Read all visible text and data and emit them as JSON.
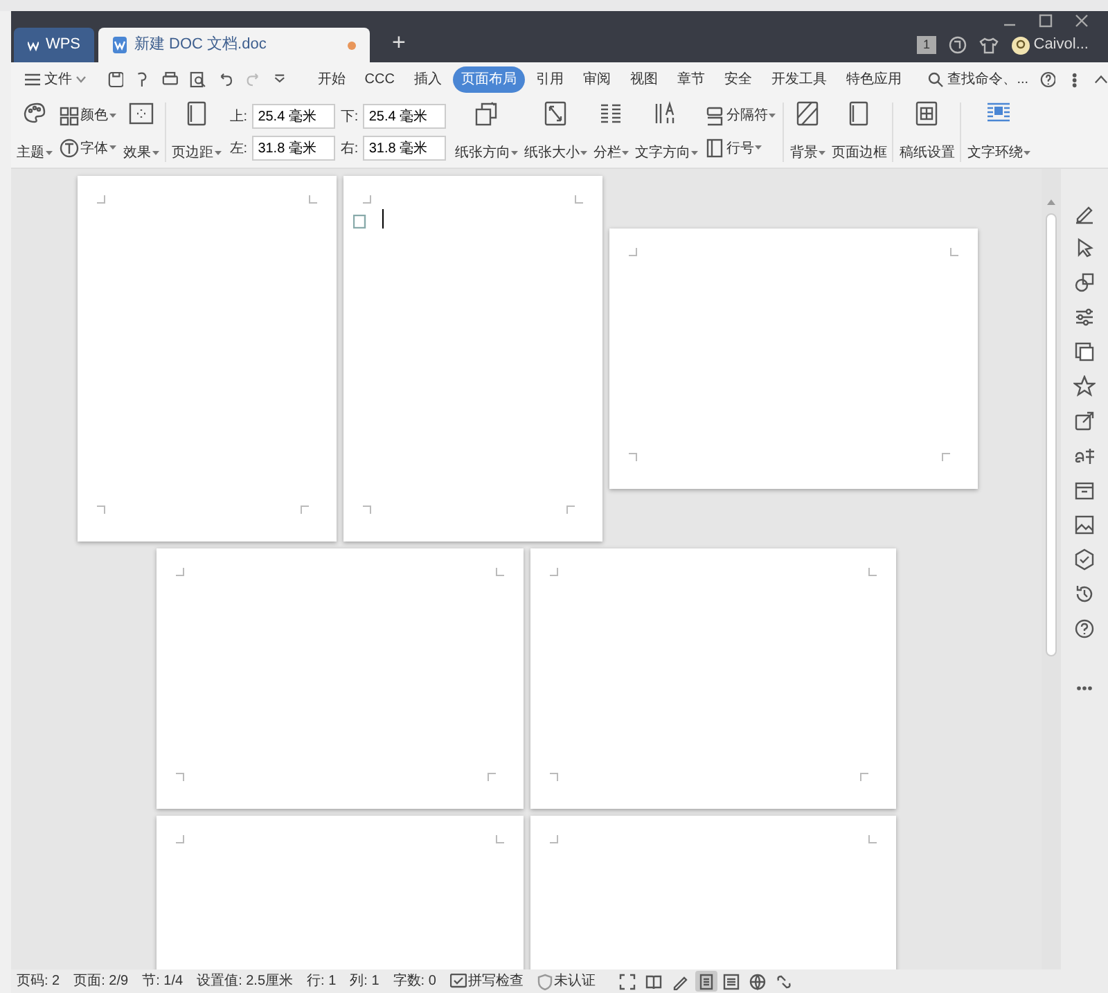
{
  "window": {
    "tabs": [
      {
        "kind": "home",
        "label": "WPS",
        "selected": false,
        "modified": false
      },
      {
        "kind": "document",
        "label": "新建 DOC 文档.doc",
        "selected": true,
        "modified": true
      }
    ],
    "new_tab": "+",
    "notice_count": "1",
    "user": "Caivol..."
  },
  "menu": {
    "file": "文件",
    "tabs": [
      {
        "label": "开始",
        "selected": false
      },
      {
        "label": "CCC",
        "selected": false
      },
      {
        "label": "插入",
        "selected": false
      },
      {
        "label": "页面布局",
        "selected": true
      },
      {
        "label": "引用",
        "selected": false
      },
      {
        "label": "审阅",
        "selected": false
      },
      {
        "label": "视图",
        "selected": false
      },
      {
        "label": "章节",
        "selected": false
      },
      {
        "label": "安全",
        "selected": false
      },
      {
        "label": "开发工具",
        "selected": false
      },
      {
        "label": "特色应用",
        "selected": false
      }
    ],
    "search": "查找命令、..."
  },
  "ribbon": [
    {
      "kind": "large",
      "label": "主题",
      "dropdown": true
    },
    {
      "kind": "stack",
      "items": [
        {
          "label": "颜色",
          "dropdown": true
        },
        {
          "label": "字体",
          "dropdown": true
        }
      ]
    },
    {
      "kind": "large",
      "label": "效果",
      "dropdown": true
    },
    {
      "kind": "divider"
    },
    {
      "kind": "large",
      "label": "页边距",
      "dropdown": true
    },
    {
      "kind": "fields",
      "items": [
        {
          "label": "上:",
          "value": "25.4 毫米"
        },
        {
          "label": "下:",
          "value": "25.4 毫米"
        },
        {
          "label": "左:",
          "value": "31.8 毫米"
        },
        {
          "label": "右:",
          "value": "31.8 毫米"
        }
      ]
    },
    {
      "kind": "large",
      "label": "纸张方向",
      "dropdown": true
    },
    {
      "kind": "large",
      "label": "纸张大小",
      "dropdown": true
    },
    {
      "kind": "large",
      "label": "分栏",
      "dropdown": true
    },
    {
      "kind": "large",
      "label": "文字方向",
      "dropdown": true
    },
    {
      "kind": "stack",
      "items": [
        {
          "label": "分隔符",
          "dropdown": true
        },
        {
          "label": "行号",
          "dropdown": true
        }
      ]
    },
    {
      "kind": "divider"
    },
    {
      "kind": "large",
      "label": "背景",
      "dropdown": true
    },
    {
      "kind": "large",
      "label": "页面边框",
      "dropdown": false
    },
    {
      "kind": "divider"
    },
    {
      "kind": "large",
      "label": "稿纸设置",
      "dropdown": false
    },
    {
      "kind": "divider"
    },
    {
      "kind": "large",
      "label": "文字环绕",
      "dropdown": true
    }
  ],
  "status_bar": {
    "items": [
      {
        "kind": "text",
        "label": "页码: 2"
      },
      {
        "kind": "text",
        "label": "页面: 2/9"
      },
      {
        "kind": "text",
        "label": "节: 1/4"
      },
      {
        "kind": "text",
        "label": "设置值: 2.5厘米"
      },
      {
        "kind": "text",
        "label": "行: 1"
      },
      {
        "kind": "text",
        "label": "列: 1"
      },
      {
        "kind": "text",
        "label": "字数: 0"
      },
      {
        "kind": "spell",
        "label": "拼写检查"
      },
      {
        "kind": "cert",
        "label": "未认证"
      }
    ],
    "views": [
      {
        "kind": "fullscreen",
        "selected": false
      },
      {
        "kind": "reading",
        "selected": false
      },
      {
        "kind": "pen",
        "selected": false
      },
      {
        "kind": "page",
        "selected": true
      },
      {
        "kind": "outline",
        "selected": false
      },
      {
        "kind": "web",
        "selected": false
      },
      {
        "kind": "more",
        "selected": false
      }
    ]
  }
}
